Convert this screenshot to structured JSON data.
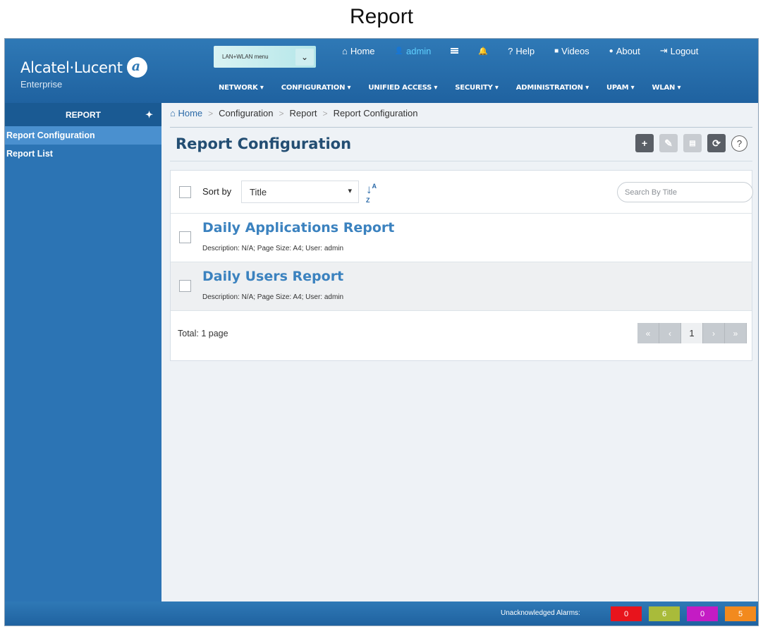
{
  "caption": "Report",
  "brand": {
    "name": "Alcatel·Lucent",
    "sub": "Enterprise"
  },
  "lan_menu": {
    "label": "LAN+WLAN menu",
    "caret": "⌄"
  },
  "toplinks": [
    {
      "label": "Home",
      "icon": "home-icon",
      "glyph": "⌂"
    },
    {
      "label": "admin",
      "icon": "user-icon",
      "glyph": "👤"
    },
    {
      "label": "",
      "icon": "list-icon",
      "glyph": ""
    },
    {
      "label": "",
      "icon": "bell-icon",
      "glyph": "🔔"
    },
    {
      "label": "Help",
      "icon": "help-icon",
      "glyph": "?"
    },
    {
      "label": "Videos",
      "icon": "video-icon",
      "glyph": "■"
    },
    {
      "label": "About",
      "icon": "info-icon",
      "glyph": "●"
    },
    {
      "label": "Logout",
      "icon": "logout-icon",
      "glyph": "⇥"
    }
  ],
  "mainnav": [
    "NETWORK ▾",
    "CONFIGURATION ▾",
    "UNIFIED ACCESS ▾",
    "SECURITY ▾",
    "ADMINISTRATION ▾",
    "UPAM ▾",
    "WLAN ▾"
  ],
  "sidebar": {
    "title": "REPORT",
    "items": [
      {
        "label": "Report Configuration",
        "active": true
      },
      {
        "label": "Report List",
        "active": false
      }
    ]
  },
  "breadcrumb": [
    "Home",
    "Configuration",
    "Report",
    "Report Configuration"
  ],
  "page_title": "Report Configuration",
  "toolbar": {
    "add": "+",
    "edit": "✎",
    "delete": "🗑",
    "refresh": "⟳",
    "help": "?"
  },
  "list": {
    "sort_label": "Sort by",
    "sort_value": "Title",
    "sort_caret": "▾",
    "sort_icon": "↓A Z",
    "search_placeholder": "Search By Title",
    "rows": [
      {
        "title": "Daily Applications Report",
        "desc": "Description: N/A; Page Size: A4; User: admin"
      },
      {
        "title": "Daily Users Report",
        "desc": "Description: N/A; Page Size: A4; User: admin"
      }
    ],
    "total": "Total: 1 page",
    "pager": [
      "«",
      "‹",
      "1",
      "›",
      "»"
    ]
  },
  "status": {
    "alarm_label": "Unacknowledged Alarms:",
    "alarms": [
      {
        "count": "0",
        "color": "#e8141c"
      },
      {
        "count": "6",
        "color": "#a9bb3a"
      },
      {
        "count": "0",
        "color": "#c41cc4"
      },
      {
        "count": "5",
        "color": "#f28a1e"
      }
    ]
  }
}
